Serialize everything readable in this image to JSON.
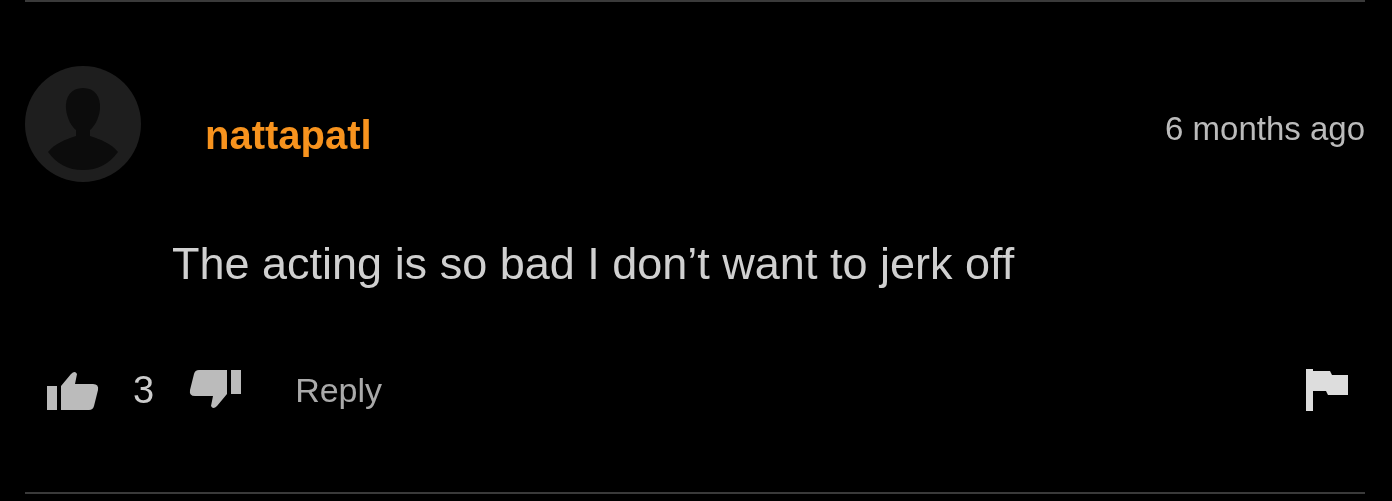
{
  "comment": {
    "author": "nattapatl",
    "time": "6 months ago",
    "text": "The acting is so bad I don’t want to jerk off",
    "likes": "3",
    "reply_label": "Reply"
  }
}
